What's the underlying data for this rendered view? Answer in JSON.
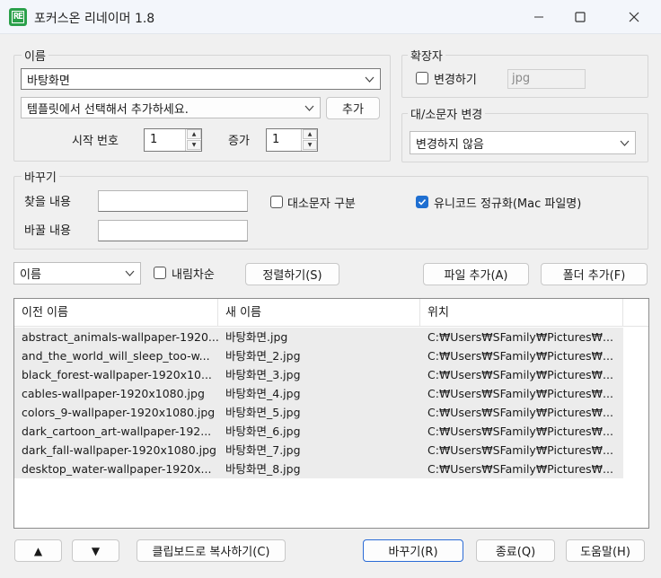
{
  "window": {
    "title": "포커스온 리네이머 1.8",
    "app_icon_text": "RE"
  },
  "name_group": {
    "label": "이름",
    "name_value": "바탕화면",
    "template_value": "템플릿에서 선택해서 추가하세요.",
    "add_label": "추가",
    "start_label": "시작 번호",
    "start_value": "1",
    "increment_label": "증가",
    "increment_value": "1"
  },
  "ext_group": {
    "label": "확장자",
    "change_label": "변경하기",
    "change_checked": false,
    "ext_value": "jpg"
  },
  "case_group": {
    "label": "대/소문자 변경",
    "value": "변경하지 않음"
  },
  "replace_group": {
    "label": "바꾸기",
    "find_label": "찾을 내용",
    "find_value": "",
    "replace_label": "바꿀 내용",
    "replace_value": "",
    "case_sensitive_label": "대소문자 구분",
    "case_sensitive_checked": false,
    "unicode_label": "유니코드 정규화(Mac 파일명)",
    "unicode_checked": true
  },
  "sort_bar": {
    "sort_field": "이름",
    "descending_label": "내림차순",
    "descending_checked": false,
    "sort_button": "정렬하기(S)",
    "add_file_button": "파일 추가(A)",
    "add_folder_button": "폴더 추가(F)"
  },
  "file_list": {
    "columns": [
      "이전 이름",
      "새 이름",
      "위치"
    ],
    "rows": [
      {
        "old": "abstract_animals-wallpaper-1920...",
        "new": "바탕화면.jpg",
        "loc": "C:₩Users₩SFamily₩Pictures₩..."
      },
      {
        "old": "and_the_world_will_sleep_too-w...",
        "new": "바탕화면_2.jpg",
        "loc": "C:₩Users₩SFamily₩Pictures₩..."
      },
      {
        "old": "black_forest-wallpaper-1920x10...",
        "new": "바탕화면_3.jpg",
        "loc": "C:₩Users₩SFamily₩Pictures₩..."
      },
      {
        "old": "cables-wallpaper-1920x1080.jpg",
        "new": "바탕화면_4.jpg",
        "loc": "C:₩Users₩SFamily₩Pictures₩..."
      },
      {
        "old": "colors_9-wallpaper-1920x1080.jpg",
        "new": "바탕화면_5.jpg",
        "loc": "C:₩Users₩SFamily₩Pictures₩..."
      },
      {
        "old": "dark_cartoon_art-wallpaper-192...",
        "new": "바탕화면_6.jpg",
        "loc": "C:₩Users₩SFamily₩Pictures₩..."
      },
      {
        "old": "dark_fall-wallpaper-1920x1080.jpg",
        "new": "바탕화면_7.jpg",
        "loc": "C:₩Users₩SFamily₩Pictures₩..."
      },
      {
        "old": "desktop_water-wallpaper-1920x...",
        "new": "바탕화면_8.jpg",
        "loc": "C:₩Users₩SFamily₩Pictures₩..."
      }
    ]
  },
  "bottom_bar": {
    "up_label": "▲",
    "down_label": "▼",
    "copy_button": "클립보드로 복사하기(C)",
    "rename_button": "바꾸기(R)",
    "exit_button": "종료(Q)",
    "help_button": "도움말(H)"
  },
  "colors": {
    "accent": "#1f6fd1",
    "checkbox_checked": "#1f6fd1",
    "app_icon": "#2aa04a",
    "list_row_bg": "#ececec"
  },
  "icons": [
    "app-logo-icon",
    "minimize-icon",
    "maximize-icon",
    "close-icon",
    "chevron-down-icon",
    "checkmark-icon"
  ]
}
